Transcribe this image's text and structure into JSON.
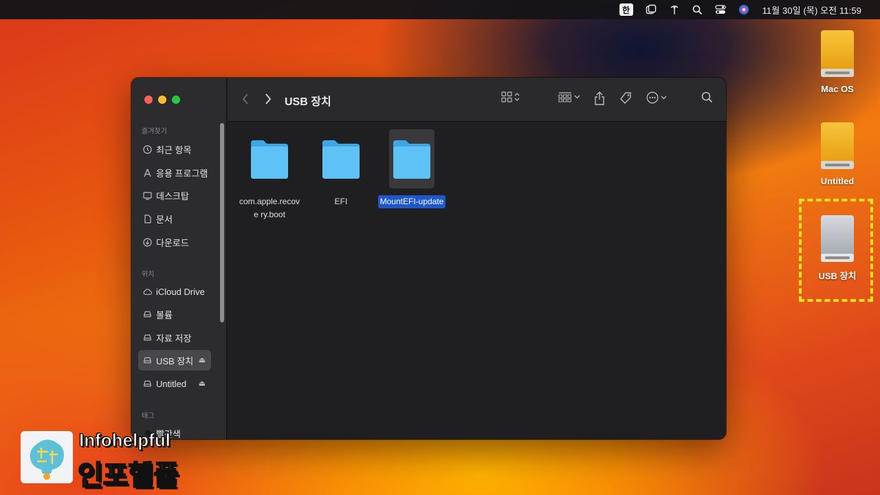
{
  "menubar": {
    "ime": "한",
    "clock": "11월 30일 (목) 오전 11:59",
    "icons": [
      "window-overlap-icon",
      "antenna-icon",
      "search-icon",
      "control-center-icon",
      "siri-icon"
    ]
  },
  "finder": {
    "title": "USB 장치",
    "sidebar": {
      "sections": {
        "favorites": "즐겨찾기",
        "locations": "위치",
        "tags": "태그"
      },
      "favorites": [
        {
          "label": "최근 항목",
          "icon": "clock-icon"
        },
        {
          "label": "응용 프로그램",
          "icon": "apps-icon"
        },
        {
          "label": "데스크탑",
          "icon": "desktop-icon"
        },
        {
          "label": "문서",
          "icon": "document-icon"
        },
        {
          "label": "다운로드",
          "icon": "download-icon"
        }
      ],
      "locations": [
        {
          "label": "iCloud Drive",
          "icon": "cloud-icon"
        },
        {
          "label": "볼륨",
          "icon": "drive-icon"
        },
        {
          "label": "자료 저장",
          "icon": "drive-icon"
        },
        {
          "label": "USB 장치",
          "icon": "drive-icon",
          "selected": true,
          "eject": true
        },
        {
          "label": "Untitled",
          "icon": "drive-icon",
          "eject": true
        }
      ],
      "tags": [
        {
          "label": "빨간색",
          "color": "#1a1a1a"
        }
      ]
    },
    "files": [
      {
        "name": "com.apple.recovery.boot",
        "display": "com.apple.recove ry.boot"
      },
      {
        "name": "EFI"
      },
      {
        "name": "MountEFI-update",
        "selected": true
      }
    ]
  },
  "desktop": {
    "icons": [
      {
        "label": "Mac OS",
        "type": "yellow-drive"
      },
      {
        "label": "Untitled",
        "type": "yellow-drive"
      },
      {
        "label": "USB 장치",
        "type": "silver-drive",
        "highlighted": true
      }
    ]
  },
  "watermark": {
    "text_en": "Infohelpful",
    "text_ko": "인포헬풀"
  },
  "colors": {
    "folder": "#4fb6f0",
    "selection": "#1d57c9",
    "highlight_border": "#f6e21c"
  }
}
